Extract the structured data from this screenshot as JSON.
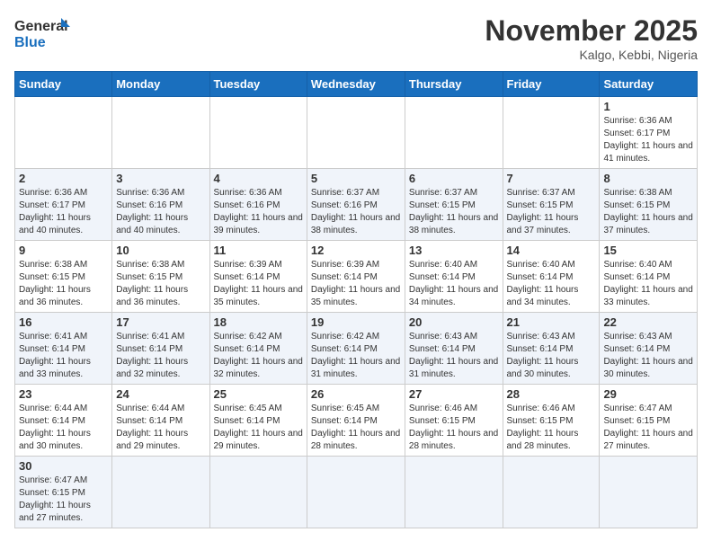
{
  "logo": {
    "text_general": "General",
    "text_blue": "Blue"
  },
  "title": "November 2025",
  "location": "Kalgo, Kebbi, Nigeria",
  "weekdays": [
    "Sunday",
    "Monday",
    "Tuesday",
    "Wednesday",
    "Thursday",
    "Friday",
    "Saturday"
  ],
  "days": [
    {
      "date": null,
      "info": null
    },
    {
      "date": null,
      "info": null
    },
    {
      "date": null,
      "info": null
    },
    {
      "date": null,
      "info": null
    },
    {
      "date": null,
      "info": null
    },
    {
      "date": null,
      "info": null
    },
    {
      "date": "1",
      "info": "Sunrise: 6:36 AM\nSunset: 6:17 PM\nDaylight: 11 hours and 41 minutes."
    },
    {
      "date": "2",
      "info": "Sunrise: 6:36 AM\nSunset: 6:17 PM\nDaylight: 11 hours and 40 minutes."
    },
    {
      "date": "3",
      "info": "Sunrise: 6:36 AM\nSunset: 6:16 PM\nDaylight: 11 hours and 40 minutes."
    },
    {
      "date": "4",
      "info": "Sunrise: 6:36 AM\nSunset: 6:16 PM\nDaylight: 11 hours and 39 minutes."
    },
    {
      "date": "5",
      "info": "Sunrise: 6:37 AM\nSunset: 6:16 PM\nDaylight: 11 hours and 38 minutes."
    },
    {
      "date": "6",
      "info": "Sunrise: 6:37 AM\nSunset: 6:15 PM\nDaylight: 11 hours and 38 minutes."
    },
    {
      "date": "7",
      "info": "Sunrise: 6:37 AM\nSunset: 6:15 PM\nDaylight: 11 hours and 37 minutes."
    },
    {
      "date": "8",
      "info": "Sunrise: 6:38 AM\nSunset: 6:15 PM\nDaylight: 11 hours and 37 minutes."
    },
    {
      "date": "9",
      "info": "Sunrise: 6:38 AM\nSunset: 6:15 PM\nDaylight: 11 hours and 36 minutes."
    },
    {
      "date": "10",
      "info": "Sunrise: 6:38 AM\nSunset: 6:15 PM\nDaylight: 11 hours and 36 minutes."
    },
    {
      "date": "11",
      "info": "Sunrise: 6:39 AM\nSunset: 6:14 PM\nDaylight: 11 hours and 35 minutes."
    },
    {
      "date": "12",
      "info": "Sunrise: 6:39 AM\nSunset: 6:14 PM\nDaylight: 11 hours and 35 minutes."
    },
    {
      "date": "13",
      "info": "Sunrise: 6:40 AM\nSunset: 6:14 PM\nDaylight: 11 hours and 34 minutes."
    },
    {
      "date": "14",
      "info": "Sunrise: 6:40 AM\nSunset: 6:14 PM\nDaylight: 11 hours and 34 minutes."
    },
    {
      "date": "15",
      "info": "Sunrise: 6:40 AM\nSunset: 6:14 PM\nDaylight: 11 hours and 33 minutes."
    },
    {
      "date": "16",
      "info": "Sunrise: 6:41 AM\nSunset: 6:14 PM\nDaylight: 11 hours and 33 minutes."
    },
    {
      "date": "17",
      "info": "Sunrise: 6:41 AM\nSunset: 6:14 PM\nDaylight: 11 hours and 32 minutes."
    },
    {
      "date": "18",
      "info": "Sunrise: 6:42 AM\nSunset: 6:14 PM\nDaylight: 11 hours and 32 minutes."
    },
    {
      "date": "19",
      "info": "Sunrise: 6:42 AM\nSunset: 6:14 PM\nDaylight: 11 hours and 31 minutes."
    },
    {
      "date": "20",
      "info": "Sunrise: 6:43 AM\nSunset: 6:14 PM\nDaylight: 11 hours and 31 minutes."
    },
    {
      "date": "21",
      "info": "Sunrise: 6:43 AM\nSunset: 6:14 PM\nDaylight: 11 hours and 30 minutes."
    },
    {
      "date": "22",
      "info": "Sunrise: 6:43 AM\nSunset: 6:14 PM\nDaylight: 11 hours and 30 minutes."
    },
    {
      "date": "23",
      "info": "Sunrise: 6:44 AM\nSunset: 6:14 PM\nDaylight: 11 hours and 30 minutes."
    },
    {
      "date": "24",
      "info": "Sunrise: 6:44 AM\nSunset: 6:14 PM\nDaylight: 11 hours and 29 minutes."
    },
    {
      "date": "25",
      "info": "Sunrise: 6:45 AM\nSunset: 6:14 PM\nDaylight: 11 hours and 29 minutes."
    },
    {
      "date": "26",
      "info": "Sunrise: 6:45 AM\nSunset: 6:14 PM\nDaylight: 11 hours and 28 minutes."
    },
    {
      "date": "27",
      "info": "Sunrise: 6:46 AM\nSunset: 6:15 PM\nDaylight: 11 hours and 28 minutes."
    },
    {
      "date": "28",
      "info": "Sunrise: 6:46 AM\nSunset: 6:15 PM\nDaylight: 11 hours and 28 minutes."
    },
    {
      "date": "29",
      "info": "Sunrise: 6:47 AM\nSunset: 6:15 PM\nDaylight: 11 hours and 27 minutes."
    },
    {
      "date": "30",
      "info": "Sunrise: 6:47 AM\nSunset: 6:15 PM\nDaylight: 11 hours and 27 minutes."
    },
    {
      "date": null,
      "info": null
    },
    {
      "date": null,
      "info": null
    },
    {
      "date": null,
      "info": null
    },
    {
      "date": null,
      "info": null
    },
    {
      "date": null,
      "info": null
    },
    {
      "date": null,
      "info": null
    }
  ]
}
